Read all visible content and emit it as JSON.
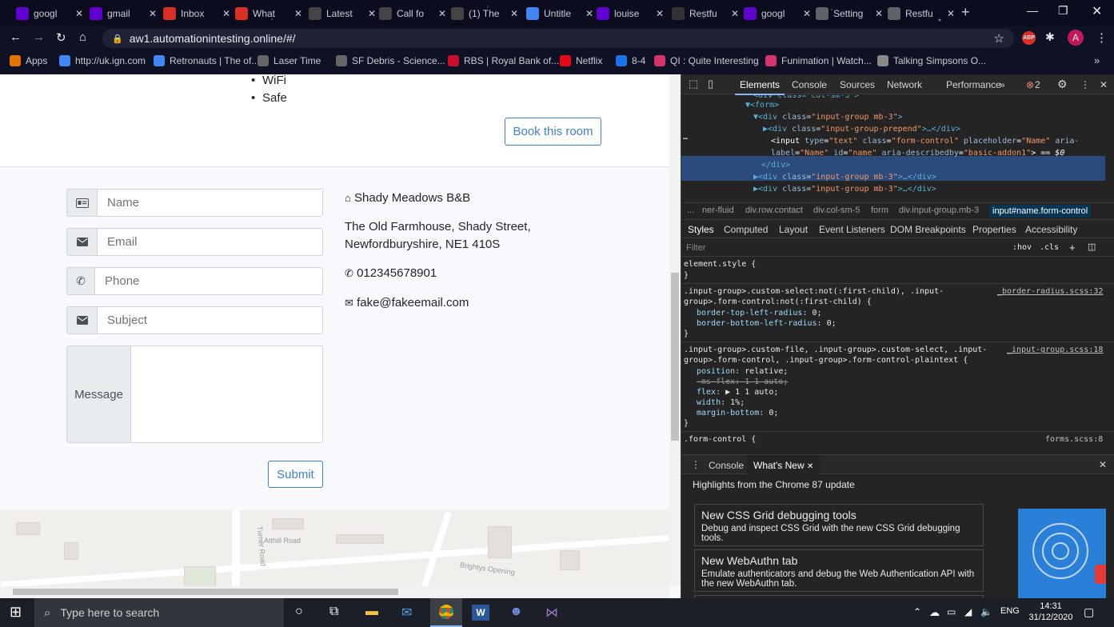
{
  "browser": {
    "tabs": [
      {
        "label": "googl",
        "icon": "yahoo-icon",
        "color": "#6001d2"
      },
      {
        "label": "gmail",
        "icon": "yahoo-icon",
        "color": "#6001d2"
      },
      {
        "label": "Inbox",
        "icon": "gmail-icon",
        "color": "#d93025"
      },
      {
        "label": "What",
        "icon": "gmail-icon",
        "color": "#d93025"
      },
      {
        "label": "Latest",
        "icon": "retronauts-icon",
        "color": "#444"
      },
      {
        "label": "Call fo",
        "icon": "retronauts-icon",
        "color": "#444"
      },
      {
        "label": "(1) The",
        "icon": "retronauts-icon",
        "color": "#444"
      },
      {
        "label": "Untitle",
        "icon": "docs-icon",
        "color": "#4285f4"
      },
      {
        "label": "louise",
        "icon": "yahoo-icon",
        "color": "#6001d2"
      },
      {
        "label": "Restfu",
        "icon": "github-icon",
        "color": "#333"
      },
      {
        "label": "googl",
        "icon": "yahoo-icon",
        "color": "#6001d2"
      },
      {
        "label": "Setting",
        "icon": "gear-icon",
        "color": "#5f6368"
      },
      {
        "label": "Restfu",
        "icon": "chrome-icon",
        "color": "#5f6368"
      }
    ],
    "url": "aw1.automationintesting.online/#/",
    "bookmarks": [
      {
        "label": "Apps",
        "color": "#e37400"
      },
      {
        "label": "http://uk.ign.com",
        "color": "#4285f4"
      },
      {
        "label": "Retronauts | The of...",
        "color": "#4285f4"
      },
      {
        "label": "Laser Time",
        "color": "#666"
      },
      {
        "label": "SF Debris - Science...",
        "color": "#666"
      },
      {
        "label": "RBS | Royal Bank of...",
        "color": "#c8102e"
      },
      {
        "label": "Netflix",
        "color": "#e50914"
      },
      {
        "label": "8-4",
        "color": "#1a73e8"
      },
      {
        "label": "QI : Quite Interesting",
        "color": "#d6336c"
      },
      {
        "label": "Funimation | Watch...",
        "color": "#d6336c"
      },
      {
        "label": "Talking Simpsons O...",
        "color": "#888"
      }
    ],
    "avatar_letter": "A"
  },
  "page": {
    "amenities": [
      "WiFi",
      "Safe"
    ],
    "book_button": "Book this room",
    "form": {
      "name_placeholder": "Name",
      "email_placeholder": "Email",
      "phone_placeholder": "Phone",
      "subject_placeholder": "Subject",
      "message_label": "Message",
      "submit_label": "Submit"
    },
    "contact": {
      "name": "Shady Meadows B&B",
      "address_line1": "The Old Farmhouse, Shady Street,",
      "address_line2": "Newfordburyshire, NE1 410S",
      "phone": "012345678901",
      "email": "fake@fakeemail.com"
    },
    "map_labels": [
      "Turner Road",
      "Atthill Road",
      "Brightys Opening"
    ]
  },
  "devtools": {
    "tabs": [
      "Elements",
      "Console",
      "Sources",
      "Network",
      "Performance"
    ],
    "error_count": "2",
    "selected_value_hint": "== $0",
    "breadcrumbs": [
      "...",
      "ner-fluid",
      "div.row.contact",
      "div.col-sm-5",
      "form",
      "div.input-group.mb-3",
      "input#name.form-control"
    ],
    "style_tabs": [
      "Styles",
      "Computed",
      "Layout",
      "Event Listeners",
      "DOM Breakpoints",
      "Properties",
      "Accessibility"
    ],
    "filter_placeholder": "Filter",
    "filter_hov": ":hov",
    "filter_cls": ".cls",
    "source1": "_border-radius.scss:32",
    "source2": "_input-group.scss:18",
    "source3": "forms.scss:8",
    "drawer_tabs": [
      "Console",
      "What's New"
    ],
    "whats_new_heading": "Highlights from the Chrome 87 update",
    "cards": [
      {
        "title": "New CSS Grid debugging tools",
        "desc": "Debug and inspect CSS Grid with the new CSS Grid debugging tools."
      },
      {
        "title": "New WebAuthn tab",
        "desc": "Emulate authenticators and debug the Web Authentication API with the new WebAuthn tab."
      }
    ]
  },
  "taskbar": {
    "search_placeholder": "Type here to search",
    "language": "ENG",
    "time": "14:31",
    "date": "31/12/2020"
  }
}
